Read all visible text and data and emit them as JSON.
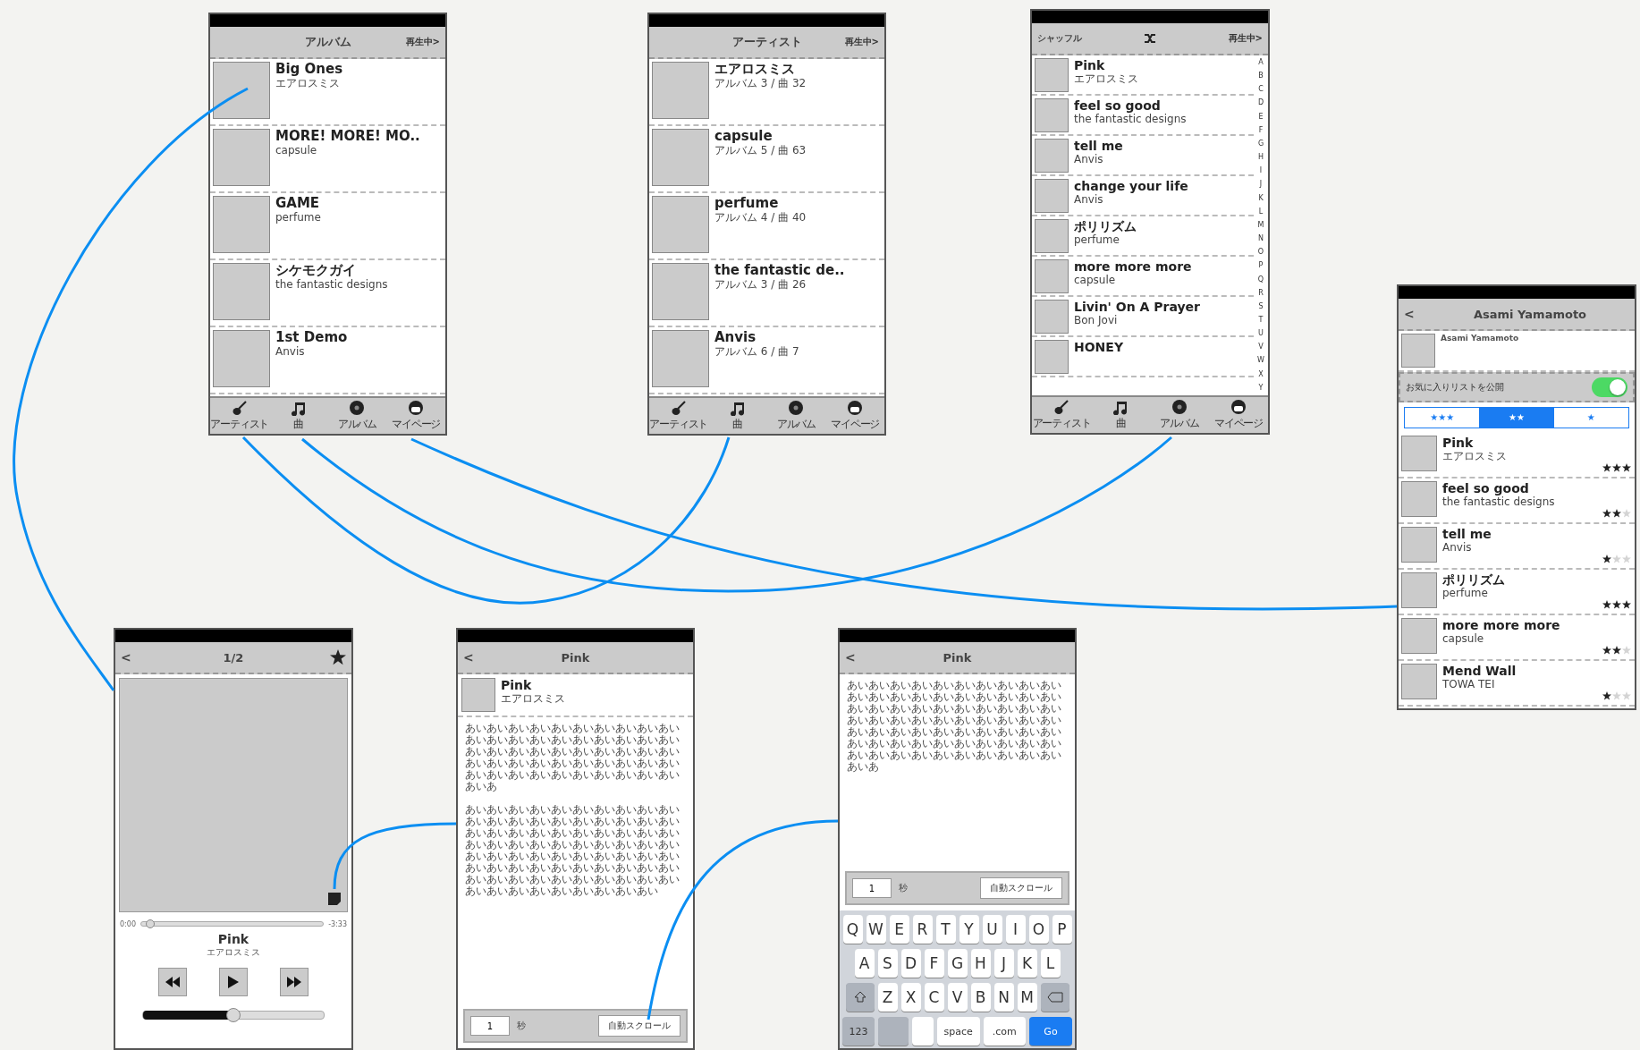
{
  "album_screen": {
    "title": "アルバム",
    "now_playing": "再生中>",
    "items": [
      {
        "title": "Big Ones",
        "subtitle": "エアロスミス"
      },
      {
        "title": "MORE! MORE! MO..",
        "subtitle": "capsule"
      },
      {
        "title": "GAME",
        "subtitle": "perfume"
      },
      {
        "title": "シケモクガイ",
        "subtitle": "the fantastic designs"
      },
      {
        "title": "1st Demo",
        "subtitle": "Anvis"
      }
    ],
    "tabs": [
      {
        "kind": "artist",
        "label": "アーティスト"
      },
      {
        "kind": "song",
        "label": "曲"
      },
      {
        "kind": "album",
        "label": "アルバム"
      },
      {
        "kind": "mypage",
        "label": "マイページ"
      }
    ]
  },
  "artist_screen": {
    "title": "アーティスト",
    "now_playing": "再生中>",
    "items": [
      {
        "title": "エアロスミス",
        "subtitle": "アルバム 3 / 曲 32"
      },
      {
        "title": "capsule",
        "subtitle": "アルバム 5 / 曲 63"
      },
      {
        "title": "perfume",
        "subtitle": "アルバム 4 / 曲 40"
      },
      {
        "title": "the fantastic de..",
        "subtitle": "アルバム 3 / 曲 26"
      },
      {
        "title": "Anvis",
        "subtitle": "アルバム 6 / 曲 7"
      }
    ],
    "tabs": [
      {
        "kind": "artist",
        "label": "アーティスト"
      },
      {
        "kind": "song",
        "label": "曲"
      },
      {
        "kind": "album",
        "label": "アルバム"
      },
      {
        "kind": "mypage",
        "label": "マイページ"
      }
    ]
  },
  "shuffle_screen": {
    "shuffle": "シャッフル",
    "now_playing": "再生中>",
    "items": [
      {
        "title": "Pink",
        "subtitle": "エアロスミス"
      },
      {
        "title": "feel so good",
        "subtitle": "the fantastic designs"
      },
      {
        "title": "tell me",
        "subtitle": "Anvis"
      },
      {
        "title": "change your life",
        "subtitle": "Anvis"
      },
      {
        "title": "ポリリズム",
        "subtitle": "perfume"
      },
      {
        "title": "more more more",
        "subtitle": "capsule"
      },
      {
        "title": "Livin' On A Prayer",
        "subtitle": "Bon Jovi"
      },
      {
        "title": "HONEY"
      }
    ],
    "index": [
      "A",
      "B",
      "C",
      "D",
      "E",
      "F",
      "G",
      "H",
      "I",
      "J",
      "K",
      "L",
      "M",
      "N",
      "O",
      "P",
      "Q",
      "R",
      "S",
      "T",
      "U",
      "V",
      "W",
      "X",
      "Y"
    ],
    "tabs": [
      {
        "kind": "artist",
        "label": "アーティスト"
      },
      {
        "kind": "song",
        "label": "曲"
      },
      {
        "kind": "album",
        "label": "アルバム"
      },
      {
        "kind": "mypage",
        "label": "マイページ"
      }
    ]
  },
  "profile_screen": {
    "back": "<",
    "title": "Asami Yamamoto",
    "profile_name": "Asami Yamamoto",
    "toggle": {
      "label": "お気に入りリストを公開",
      "on": true
    },
    "segments": [
      {
        "label": "★★★",
        "selected": false
      },
      {
        "label": "★★",
        "selected": true
      },
      {
        "label": "★",
        "selected": false
      }
    ],
    "items": [
      {
        "title": "Pink",
        "subtitle": "エアロスミス",
        "stars": 3
      },
      {
        "title": "feel so good",
        "subtitle": "the fantastic designs",
        "stars": 2
      },
      {
        "title": "tell me",
        "subtitle": "Anvis",
        "stars": 1
      },
      {
        "title": "ポリリズム",
        "subtitle": "perfume",
        "stars": 3
      },
      {
        "title": "more more more",
        "subtitle": "capsule",
        "stars": 2
      },
      {
        "title": "Mend Wall",
        "subtitle": "TOWA TEI",
        "stars": 1
      }
    ]
  },
  "player_screen": {
    "back": "<",
    "counter": "1/2",
    "elapsed": "0:00",
    "remaining": "-3:33",
    "position": {
      "level": 0.05
    },
    "title": "Pink",
    "artist": "エアロスミス",
    "volume": {
      "level": 0.5
    }
  },
  "lyrics_screen": {
    "back": "<",
    "title": "Pink",
    "song": {
      "title": "Pink",
      "artist": "エアロスミス"
    },
    "paragraphs": [
      "あいあいあいあいあいあいあいあいあいあいあいあいあいあいあいあいあいあいあいあいあいあいあいあいあいあいあいあいあいあいあいあいあいあいあいあいあいあいあいあいあいあいあいあいあいあいあいあいあいあいあいあ",
      "あいあいあいあいあいあいあいあいあいあいあいあいあいあいあいあいあいあいあいあいあいあいあいあいあいあいあいあいあいあいあいあいあいあいあいあいあいあいあいあいあいあいあいあいあいあいあいあいあいあいあいあいあいあいあいあいあいあいあいあいあいあいあいあいあいあいあいあいあいあいあいあいあいあいあいあいあいあいあい"
    ],
    "footer": {
      "value": "1",
      "unit": "秒",
      "button": "自動スクロール"
    }
  },
  "edit_screen": {
    "back": "<",
    "title": "Pink",
    "paragraphs": [
      "あいあいあいあいあいあいあいあいあいあいあいあいあいあいあいあいあいあいあいあいあいあいあいあいあいあいあいあいあいあいあいあいあいあいあいあいあいあいあいあいあいあいあいあいあいあいあいあいあいあいあいあいあいあいあいあいあいあいあいあいあいあいあいあいあいあいあいあいあいあいあいあ"
    ],
    "footer": {
      "value": "1",
      "unit": "秒",
      "button": "自動スクロール"
    },
    "keyboard": {
      "rows": [
        [
          "Q",
          "W",
          "E",
          "R",
          "T",
          "Y",
          "U",
          "I",
          "O",
          "P"
        ],
        [
          "A",
          "S",
          "D",
          "F",
          "G",
          "H",
          "J",
          "K",
          "L"
        ],
        [
          "Z",
          "X",
          "C",
          "V",
          "B",
          "N",
          "M"
        ]
      ],
      "bottom": [
        {
          "kind": "mode",
          "label": "123"
        },
        {
          "kind": "blank"
        },
        {
          "kind": "blankwhite"
        },
        {
          "kind": "key",
          "label": "space"
        },
        {
          "kind": "key",
          "label": ".com"
        },
        {
          "kind": "action",
          "label": "Go"
        }
      ]
    }
  }
}
